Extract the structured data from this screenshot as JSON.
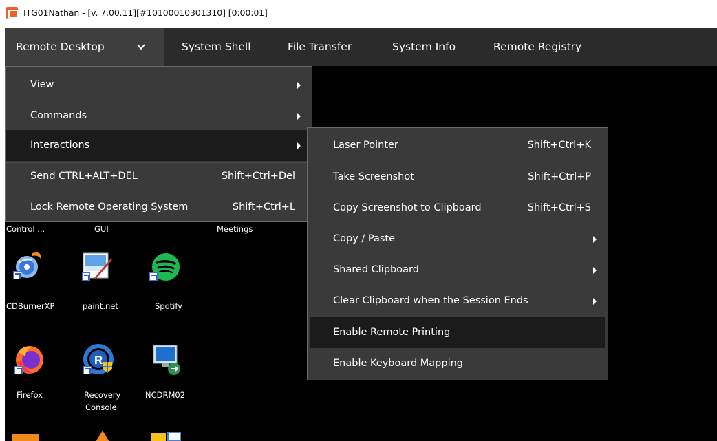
{
  "window": {
    "title": "ITG01Nathan - [v. 7.00.11][#10100010301310] [0:00:01]"
  },
  "menubar": {
    "tabs": [
      {
        "label": "Remote Desktop"
      },
      {
        "label": "System Shell"
      },
      {
        "label": "File Transfer"
      },
      {
        "label": "System Info"
      },
      {
        "label": "Remote Registry"
      }
    ]
  },
  "remote_desktop_menu": {
    "items": [
      {
        "label": "View",
        "shortcut": ""
      },
      {
        "label": "Commands",
        "shortcut": ""
      },
      {
        "label": "Interactions",
        "shortcut": ""
      },
      {
        "label": "Send CTRL+ALT+DEL",
        "shortcut": "Shift+Ctrl+Del"
      },
      {
        "label": "Lock Remote Operating System",
        "shortcut": "Shift+Ctrl+L"
      }
    ]
  },
  "interactions_menu": {
    "items": [
      {
        "label": "Laser Pointer",
        "shortcut": "Shift+Ctrl+K"
      },
      {
        "label": "Take Screenshot",
        "shortcut": "Shift+Ctrl+P"
      },
      {
        "label": "Copy Screenshot to Clipboard",
        "shortcut": "Shift+Ctrl+S"
      },
      {
        "label": "Copy / Paste",
        "shortcut": ""
      },
      {
        "label": "Shared Clipboard",
        "shortcut": ""
      },
      {
        "label": "Clear Clipboard when the Session Ends",
        "shortcut": ""
      },
      {
        "label": "Enable Remote Printing",
        "shortcut": ""
      },
      {
        "label": "Enable Keyboard Mapping",
        "shortcut": ""
      }
    ]
  },
  "desktop": {
    "partial_labels": [
      "Control ...",
      "GUI",
      "Meetings"
    ],
    "icons": [
      {
        "label": "CDBurnerXP",
        "icon": "cdburnerxp-icon"
      },
      {
        "label": "paint.net",
        "icon": "paintnet-icon"
      },
      {
        "label": "Spotify",
        "icon": "spotify-icon"
      },
      {
        "label": "Firefox",
        "icon": "firefox-icon"
      },
      {
        "label": "Recovery",
        "label2": "Console",
        "icon": "recovery-console-icon"
      },
      {
        "label": "NCDRM02",
        "icon": "remote-desktop-icon"
      }
    ]
  },
  "colors": {
    "menubar": "#2b2b2b",
    "menu_bg": "#3a3a3a",
    "highlight": "#1b1b1b",
    "desktop": "#000000",
    "app_icon": "#e8622a"
  }
}
